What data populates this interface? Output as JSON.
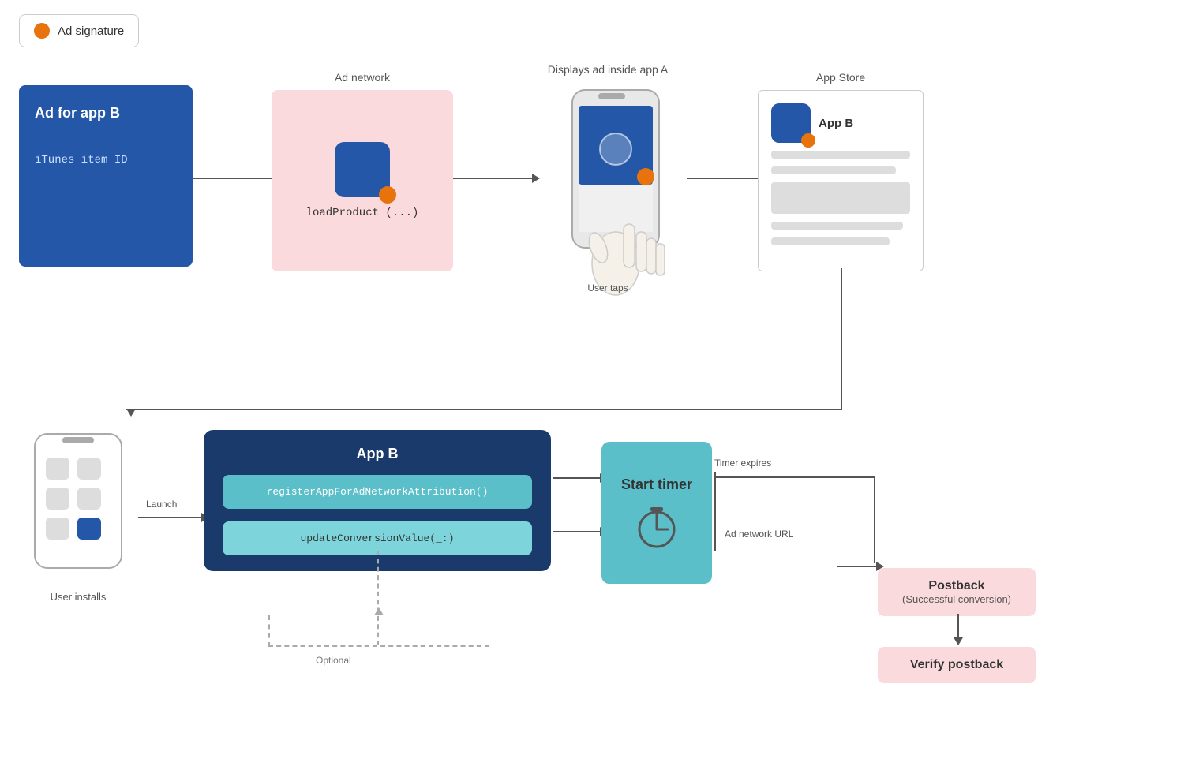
{
  "legend": {
    "dot_color": "#E8720C",
    "label": "Ad signature"
  },
  "top_row": {
    "ad_box": {
      "title": "Ad for app B",
      "subtitle": "iTunes item ID"
    },
    "ad_network": {
      "label": "Ad network",
      "method": "loadProduct (...)"
    },
    "phone_display": {
      "label": "Displays ad inside app A",
      "user_taps": "User taps"
    },
    "app_store": {
      "label": "App Store",
      "app_name": "App B"
    }
  },
  "bottom_row": {
    "user_installs": {
      "label": "User installs"
    },
    "launch_label": "Launch",
    "app_b_box": {
      "title": "App B",
      "register_method": "registerAppForAdNetworkAttribution()",
      "update_method": "updateConversionValue(_:)"
    },
    "start_timer": {
      "label": "Start timer"
    },
    "timer_expires": "Timer expires",
    "ad_network_url": "Ad network URL",
    "postback": {
      "title": "Postback",
      "subtitle": "(Successful conversion)"
    },
    "verify_postback": {
      "title": "Verify postback"
    },
    "optional_label": "Optional"
  }
}
